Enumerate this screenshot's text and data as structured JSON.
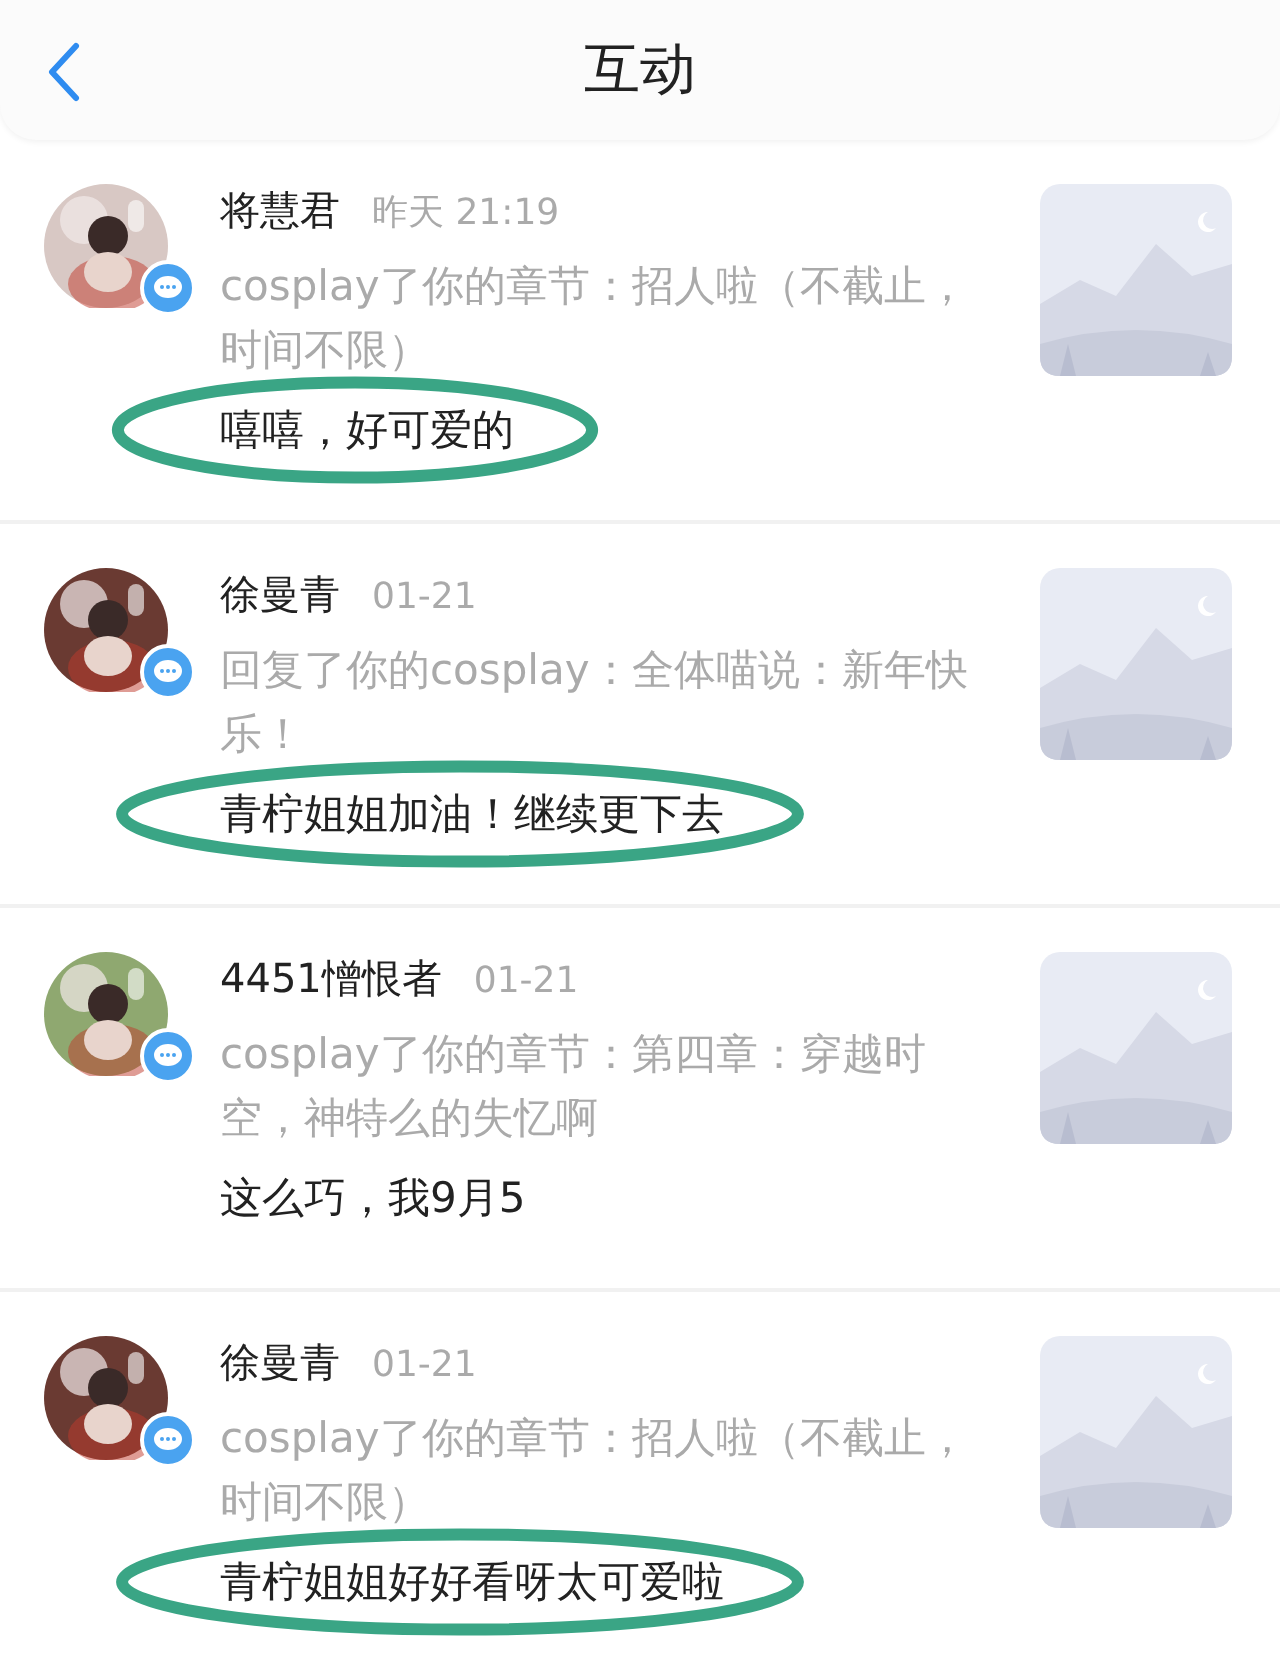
{
  "header": {
    "title": "互动"
  },
  "items": [
    {
      "name": "将慧君",
      "time": "昨天 21:19",
      "description": "cosplay了你的章节：招人啦（不截止，时间不限）",
      "reply": "嘻嘻，好可爱的",
      "highlighted": true
    },
    {
      "name": "徐曼青",
      "time": "01-21",
      "description": "回复了你的cosplay：全体喵说：新年快乐！",
      "reply": "青柠姐姐加油！继续更下去",
      "highlighted": true
    },
    {
      "name": "4451憎恨者",
      "time": "01-21",
      "description": "cosplay了你的章节：第四章：穿越时空，神特么的失忆啊",
      "reply": "这么巧，我9月5",
      "highlighted": false
    },
    {
      "name": "徐曼青",
      "time": "01-21",
      "description": "cosplay了你的章节：招人啦（不截止，时间不限）",
      "reply": "青柠姐姐好好看呀太可爱啦",
      "highlighted": true
    }
  ]
}
